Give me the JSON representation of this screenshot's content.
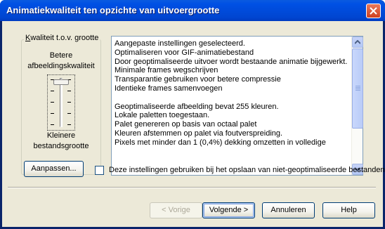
{
  "window": {
    "title": "Animatiekwaliteit ten opzichte van uitvoergrootte"
  },
  "quality_group": {
    "legend_first": "K",
    "legend_rest": "waliteit t.o.v. grootte",
    "top_label_1": "Betere",
    "top_label_2": "afbeeldingskwaliteit",
    "bottom_label_1": "Kleinere",
    "bottom_label_2": "bestandsgrootte",
    "slider_position": "top"
  },
  "info": {
    "lines_a": [
      "Aangepaste instellingen geselecteerd.",
      "Optimaliseren voor GIF-animatiebestand",
      "Door geoptimaliseerde uitvoer wordt bestaande animatie bijgewerkt.",
      "Minimale frames wegschrijven",
      "Transparantie gebruiken voor betere compressie",
      "Identieke frames samenvoegen"
    ],
    "lines_b": [
      "Geoptimaliseerde afbeelding bevat 255 kleuren.",
      "Lokale paletten toegestaan.",
      "Palet genereren op basis van octaal palet",
      "Kleuren afstemmen op palet via foutverspreiding.",
      "Pixels met minder dan 1 (0,4%) dekking omzetten in volledige"
    ]
  },
  "customize_button": {
    "label": "Aanpassen..."
  },
  "checkbox": {
    "label": "Deze instellingen gebruiken bij het opslaan van niet-geoptimaliseerde bestanden",
    "checked": false
  },
  "footer": {
    "back": "< Vorige",
    "next": "Volgende >",
    "cancel": "Annuleren",
    "help": "Help"
  }
}
